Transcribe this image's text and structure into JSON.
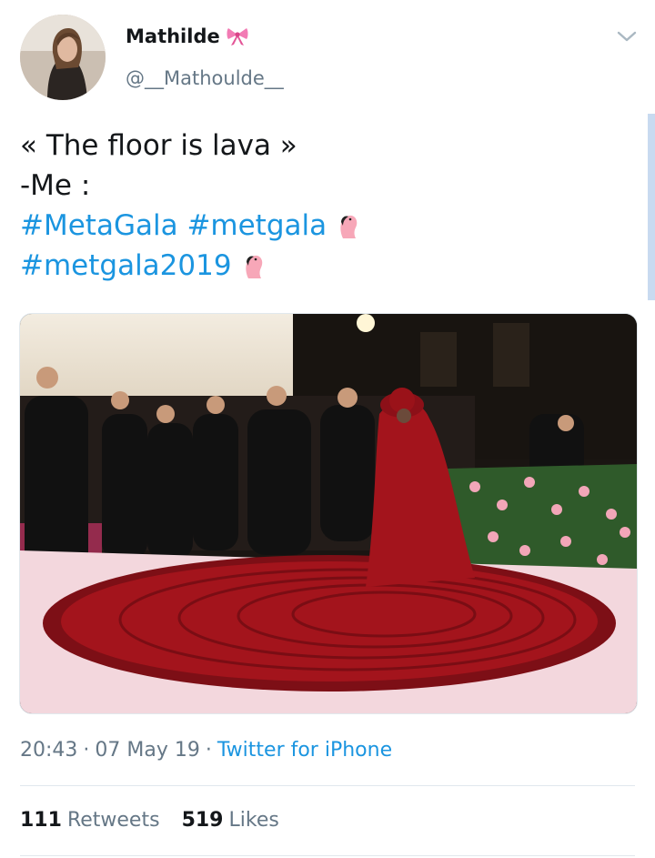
{
  "author": {
    "name": "Mathilde",
    "handle": "@__Mathoulde__",
    "name_emoji": "ribbon-icon"
  },
  "tweet": {
    "line1": "« The floor is lava »",
    "line2": "-Me :",
    "hashtags_line1": [
      "#MetaGala",
      "#metgala"
    ],
    "hashtags_line2": [
      "#metgala2019"
    ],
    "emoji": "flamingo-icon"
  },
  "meta": {
    "time": "20:43",
    "sep1": "·",
    "date": "07 May 19",
    "sep2": "·",
    "source": "Twitter for iPhone"
  },
  "stats": {
    "retweets_count": "111",
    "retweets_label": "Retweets",
    "likes_count": "519",
    "likes_label": "Likes"
  },
  "colors": {
    "link": "#1b95e0",
    "secondary_text": "#657786",
    "gown": "#a3141c"
  }
}
